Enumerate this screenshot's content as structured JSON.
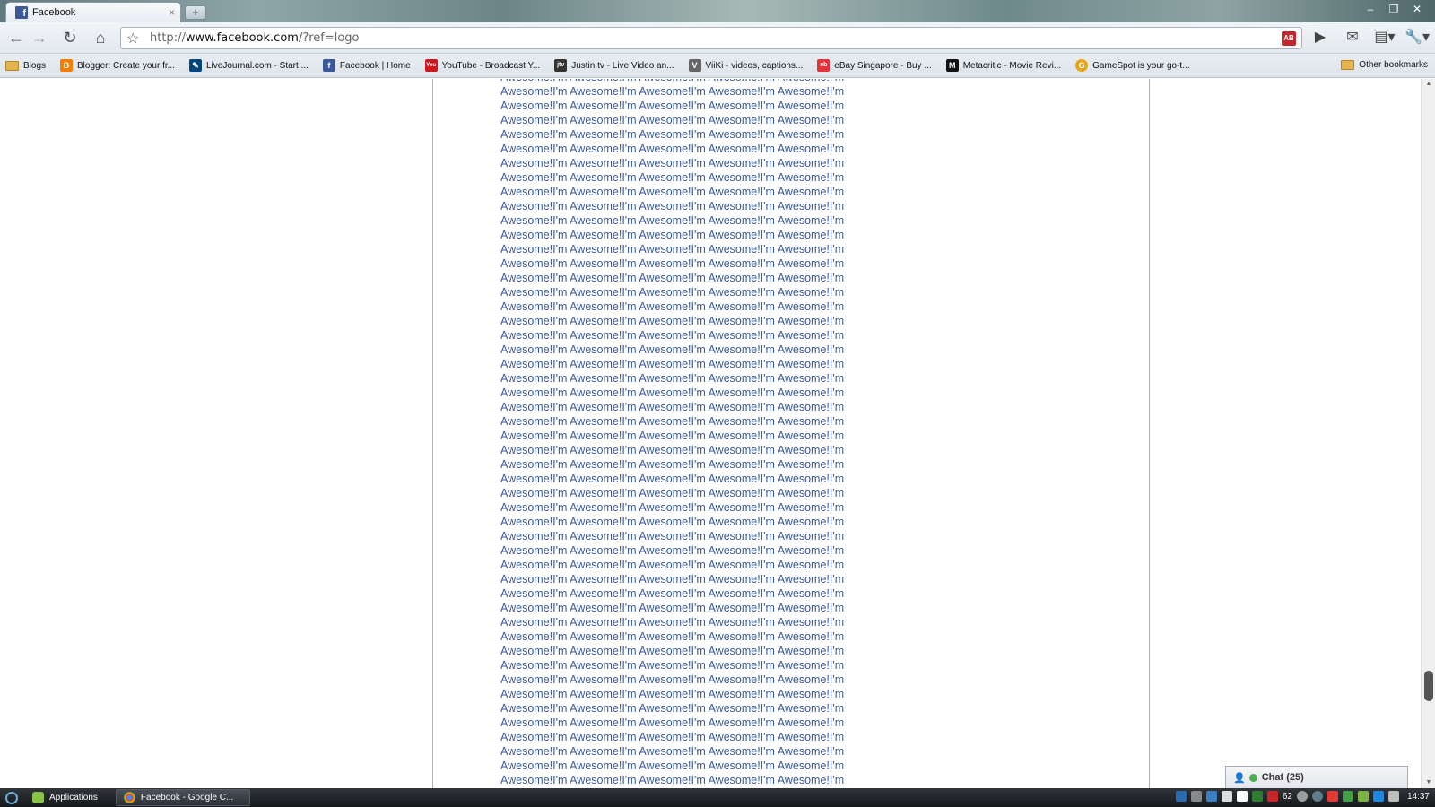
{
  "browser": {
    "tab_title": "Facebook",
    "tab_close": "×",
    "new_tab": "+",
    "url_prefix": "http://",
    "url_host": "www.facebook.com",
    "url_path": "/?ref=logo",
    "window_controls": [
      "–",
      "❐",
      "✕"
    ]
  },
  "bookmarks": [
    {
      "label": "Blogs",
      "icon": "folder-icon",
      "color": "#e3b44b"
    },
    {
      "label": "Blogger: Create your fr...",
      "icon": "blogger-icon",
      "color": "#f57d00"
    },
    {
      "label": "LiveJournal.com - Start ...",
      "icon": "livejournal-icon",
      "color": "#00457c"
    },
    {
      "label": "Facebook | Home",
      "icon": "facebook-icon",
      "color": "#3b5998"
    },
    {
      "label": "YouTube - Broadcast Y...",
      "icon": "youtube-icon",
      "color": "#cc181e"
    },
    {
      "label": "Justin.tv - Live Video an...",
      "icon": "justintv-icon",
      "color": "#333333"
    },
    {
      "label": "ViiKi - videos, captions...",
      "icon": "viiki-icon",
      "color": "#666666"
    },
    {
      "label": "eBay Singapore - Buy ...",
      "icon": "ebay-icon",
      "color": "#e53238"
    },
    {
      "label": "Metacritic - Movie Revi...",
      "icon": "metacritic-icon",
      "color": "#111111"
    },
    {
      "label": "GameSpot is your go-t...",
      "icon": "gamespot-icon",
      "color": "#e8a317"
    }
  ],
  "other_bookmarks": "Other bookmarks",
  "page": {
    "line_text": "Awesome!I'm Awesome!I'm Awesome!I'm Awesome!I'm Awesome!I'm",
    "line_count": 50,
    "text_color": "#3b5998"
  },
  "chat": {
    "label": "Chat (25)"
  },
  "taskbar": {
    "applications": "Applications",
    "active_window": "Facebook - Google C...",
    "tray_number": "62",
    "clock": "14:37"
  }
}
